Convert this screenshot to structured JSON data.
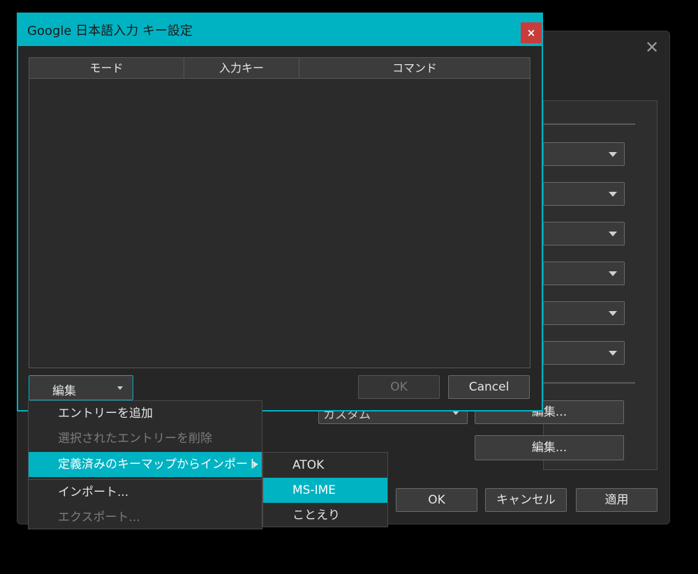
{
  "background_window": {
    "close_glyph": "✕",
    "custom_dropdown_value": "カスタム",
    "edit_button_1": "編集...",
    "edit_button_2": "編集...",
    "ok_label": "OK",
    "cancel_label": "キャンセル",
    "apply_label": "適用"
  },
  "dialog": {
    "title": "Google 日本語入力 キー設定",
    "close_glyph": "×",
    "columns": [
      "モード",
      "入力キー",
      "コマンド"
    ],
    "edit_button_label": "編集",
    "ok_label": "OK",
    "cancel_label": "Cancel"
  },
  "menu": {
    "items": [
      {
        "label": "エントリーを追加",
        "enabled": true
      },
      {
        "label": "選択されたエントリーを削除",
        "enabled": false
      },
      {
        "label": "定義済みのキーマップからインポート",
        "enabled": true,
        "highlighted": true,
        "has_submenu": true
      },
      {
        "label": "インポート...",
        "enabled": true
      },
      {
        "label": "エクスポート...",
        "enabled": false
      }
    ],
    "submenu": [
      {
        "label": "ATOK"
      },
      {
        "label": "MS-IME",
        "highlighted": true
      },
      {
        "label": "ことえり"
      }
    ]
  },
  "colors": {
    "accent": "#00b3c2",
    "close_red": "#c83c3c"
  }
}
